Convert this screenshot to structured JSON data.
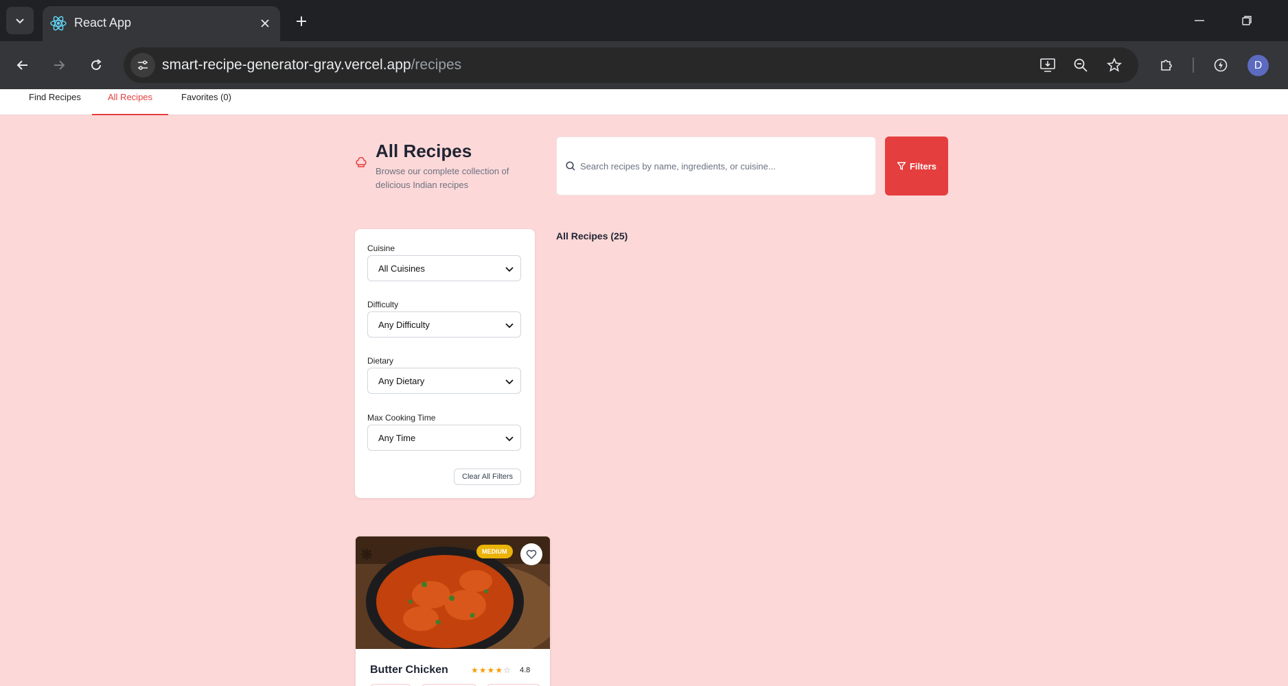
{
  "browser": {
    "tab_title": "React App",
    "url_host": "smart-recipe-generator-gray.vercel.app",
    "url_path": "/recipes",
    "avatar_letter": "D"
  },
  "nav": {
    "tabs": [
      {
        "label": "Find Recipes",
        "active": false
      },
      {
        "label": "All Recipes",
        "active": true
      },
      {
        "label": "Favorites (0)",
        "active": false
      }
    ]
  },
  "header": {
    "title": "All Recipes",
    "subtitle": "Browse our complete collection of delicious Indian recipes",
    "icon": "chef-hat-icon"
  },
  "search": {
    "placeholder": "Search recipes by name, ingredients, or cuisine...",
    "value": ""
  },
  "filters_button": {
    "label": "Filters"
  },
  "filters": {
    "cuisine": {
      "label": "Cuisine",
      "selected": "All Cuisines"
    },
    "difficulty": {
      "label": "Difficulty",
      "selected": "Any Difficulty"
    },
    "dietary": {
      "label": "Dietary",
      "selected": "Any Dietary"
    },
    "max_time": {
      "label": "Max Cooking Time",
      "selected": "Any Time"
    },
    "clear_label": "Clear All Filters"
  },
  "results": {
    "title": "All Recipes (25)"
  },
  "recipes": [
    {
      "name": "Butter Chicken",
      "difficulty": "MEDIUM",
      "rating": "4.8",
      "stars_filled": 4,
      "stars_total": 5
    }
  ],
  "colors": {
    "accent": "#e53e3e",
    "page_bg": "#fdd8d8",
    "badge": "#eab308",
    "star": "#f59e0b"
  }
}
